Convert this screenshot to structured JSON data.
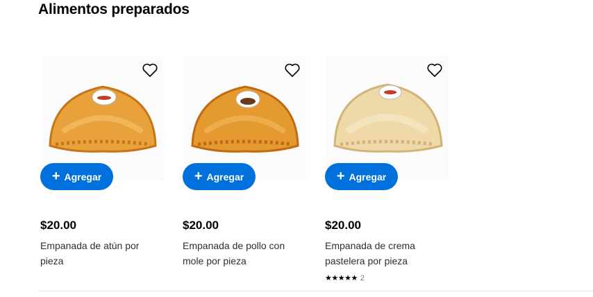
{
  "section": {
    "title": "Alimentos preparados"
  },
  "products": [
    {
      "price": "$20.00",
      "name": "Empanada de atún por pieza",
      "add_label": "Agregar",
      "image": "tuna-empanada",
      "sticker_color": "#c43b2a",
      "crust_color": "#e9a23b"
    },
    {
      "price": "$20.00",
      "name": "Empanada de pollo con mole por pieza",
      "add_label": "Agregar",
      "image": "chicken-mole-empanada",
      "sticker_color": "#6b3a1e",
      "crust_color": "#e59a30"
    },
    {
      "price": "$20.00",
      "name": "Empanada de crema pastelera por pieza",
      "add_label": "Agregar",
      "image": "custard-empanada",
      "sticker_color": "#c43b2a",
      "crust_color": "#efd9a8",
      "rating": {
        "stars": 5,
        "count": "2"
      }
    }
  ],
  "colors": {
    "primary": "#0071dc",
    "text": "#2e2f32"
  },
  "icons": {
    "favorite": "heart-outline-icon",
    "add": "plus-icon",
    "rating": "star-icon"
  }
}
